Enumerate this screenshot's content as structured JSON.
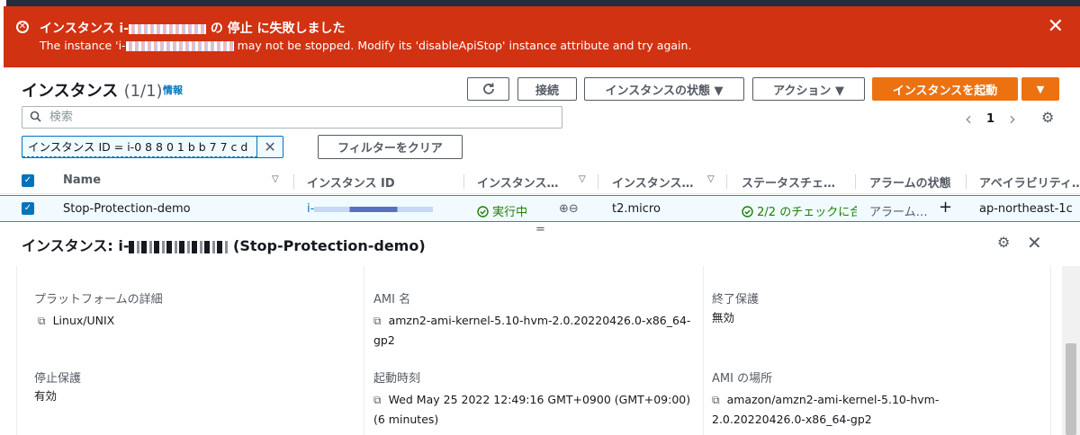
{
  "alert": {
    "title_prefix": "インスタンス i-",
    "title_suffix": "の 停止 に失敗しました",
    "message_prefix": "The instance 'i-",
    "message_suffix": "may not be stopped. Modify its 'disableApiStop' instance attribute and try again.",
    "close_icon": "close-icon",
    "color": "#d13212"
  },
  "header": {
    "title": "インスタンス",
    "count": "(1/1)",
    "info": "情報"
  },
  "toolbar": {
    "refresh_icon": "refresh-icon",
    "connect": "接続",
    "instance_state": "インスタンスの状態 ▼",
    "actions": "アクション ▼",
    "launch": "インスタンスを起動",
    "launch_dropdown": "▼",
    "accent_color": "#ec7211"
  },
  "search": {
    "placeholder": "検索",
    "value": ""
  },
  "pagination": {
    "prev": "‹",
    "page": "1",
    "next": "›"
  },
  "filter": {
    "token": "インスタンス ID = i-0 8 8 0 1 b b 7 7 c d",
    "remove": "✕",
    "clear": "フィルターをクリア"
  },
  "table": {
    "columns": [
      "Name",
      "インスタンス ID",
      "インスタンス…",
      "インスタンス…",
      "ステータスチェ…",
      "アラームの状態",
      "アベイラビリティ…"
    ],
    "rows": [
      {
        "name": "Stop-Protection-demo",
        "id": "i-",
        "state": "実行中",
        "type": "t2.micro",
        "status": "2/2 のチェックに合",
        "alarm": "アラーム…",
        "alarm_add": "+",
        "az": "ap-northeast-1c"
      }
    ]
  },
  "detail": {
    "title_prefix": "インスタンス: i-",
    "title_suffix": "(Stop-Protection-demo)",
    "splitter": "="
  },
  "details": {
    "platform_label": "プラットフォームの詳細",
    "platform_value": "Linux/UNIX",
    "ami_name_label": "AMI 名",
    "ami_name_value": "amzn2-ami-kernel-5.10-hvm-2.0.20220426.0-x86_64-gp2",
    "termination_label": "終了保護",
    "termination_value": "無効",
    "stop_label": "停止保護",
    "stop_value": "有効",
    "launch_time_label": "起動時刻",
    "launch_time_value": "Wed May 25 2022 12:49:16 GMT+0900 (GMT+09:00) (6 minutes)",
    "ami_location_label": "AMI の場所",
    "ami_location_value": "amazon/amzn2-ami-kernel-5.10-hvm-2.0.20220426.0-x86_64-gp2"
  }
}
